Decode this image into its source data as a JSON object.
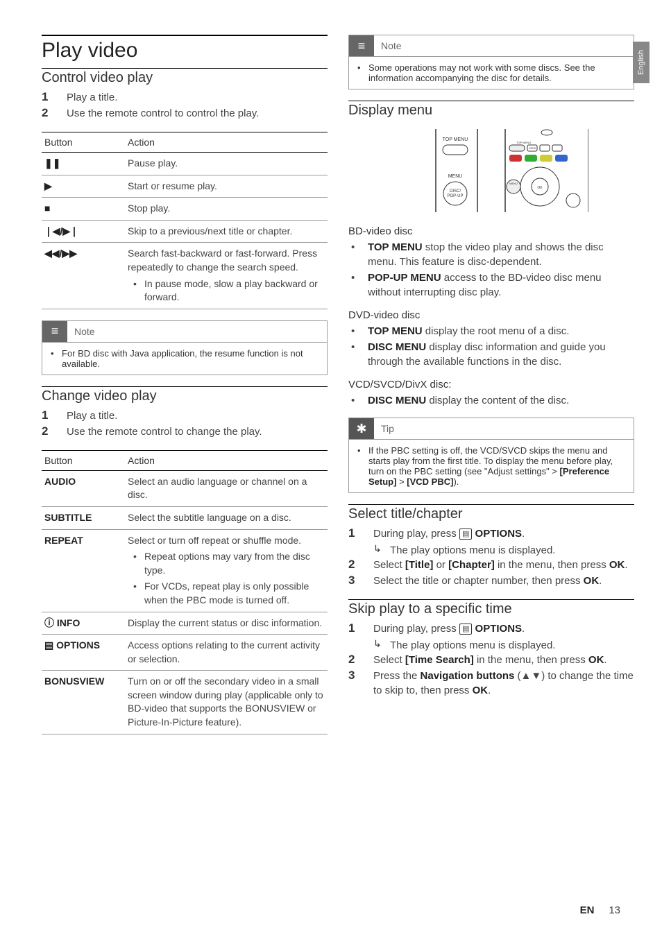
{
  "page": {
    "lang_tab": "English",
    "footer_lang": "EN",
    "footer_page": "13"
  },
  "left": {
    "h1": "Play video",
    "section1": {
      "heading": "Control video play",
      "steps": [
        "Play a title.",
        "Use the remote control to control the play."
      ],
      "table": {
        "headers": [
          "Button",
          "Action"
        ],
        "rows": [
          {
            "btn": "❚❚",
            "action": "Pause play."
          },
          {
            "btn": "▶",
            "action": "Start or resume play."
          },
          {
            "btn": "■",
            "action": "Stop play."
          },
          {
            "btn": "❘◀/▶❘",
            "action": "Skip to a previous/next title or chapter."
          },
          {
            "btn": "◀◀/▶▶",
            "action": "Search fast-backward or fast-forward. Press repeatedly to change the search speed.",
            "sub": "In pause mode, slow a play backward or forward."
          }
        ]
      },
      "note": {
        "title": "Note",
        "text": "For BD disc with Java application, the resume function is not available."
      }
    },
    "section2": {
      "heading": "Change video play",
      "steps": [
        "Play a title.",
        "Use the remote control to change the play."
      ],
      "table": {
        "headers": [
          "Button",
          "Action"
        ],
        "rows": [
          {
            "btn": "AUDIO",
            "action": "Select an audio language or channel on a disc."
          },
          {
            "btn": "SUBTITLE",
            "action": "Select the subtitle language on a disc."
          },
          {
            "btn": "REPEAT",
            "action": "Select or turn off repeat or shuffle mode.",
            "subs": [
              "Repeat options may vary from the disc type.",
              "For VCDs, repeat play is only possible when the PBC mode is turned off."
            ]
          },
          {
            "btn": "ⓘ INFO",
            "action": "Display the current status or disc information."
          },
          {
            "btn": "▤ OPTIONS",
            "action": "Access options relating to the current activity or selection."
          },
          {
            "btn": "BONUSVIEW",
            "action": "Turn on or off the secondary video in a small screen window during play (applicable only to BD-video that supports the BONUSVIEW or Picture-In-Picture feature)."
          }
        ]
      }
    }
  },
  "right": {
    "note1": {
      "title": "Note",
      "text": "Some operations may not work with some discs. See the information accompanying the disc for details."
    },
    "section1": {
      "heading": "Display menu",
      "diagram_labels": {
        "top_menu": "TOP MENU",
        "menu": "MENU",
        "disc_popup": "DISC/\nPOP-UP"
      },
      "bd": {
        "title": "BD-video disc",
        "items": [
          {
            "lead": "TOP MENU",
            "text": " stop the video play and shows the disc menu. This feature is disc-dependent."
          },
          {
            "lead": "POP-UP MENU",
            "text": " access to the BD-video disc menu without interrupting disc play."
          }
        ]
      },
      "dvd": {
        "title": "DVD-video disc",
        "items": [
          {
            "lead": "TOP MENU",
            "text": " display the root menu of a disc."
          },
          {
            "lead": "DISC MENU",
            "text": " display disc information and guide you through the available functions in the disc."
          }
        ]
      },
      "vcd": {
        "title": "VCD/SVCD/DivX disc:",
        "items": [
          {
            "lead": "DISC MENU",
            "text": " display the content of the disc."
          }
        ]
      },
      "tip": {
        "title": "Tip",
        "text_parts": {
          "p1": "If the PBC setting is off, the VCD/SVCD skips the menu and starts play from the first title. To display the menu before play, turn on the PBC setting (see \"Adjust settings\" > ",
          "b1": "[Preference Setup]",
          "p2": " > ",
          "b2": "[VCD PBC]",
          "p3": ")."
        }
      }
    },
    "section2": {
      "heading": "Select title/chapter",
      "steps": [
        {
          "main_parts": {
            "p1": "During play, press ",
            "icon": "▤",
            "b1": " OPTIONS",
            "p2": "."
          },
          "sub": "The play options menu is displayed."
        },
        {
          "main_parts": {
            "p1": "Select ",
            "b1": "[Title]",
            "p2": " or ",
            "b2": "[Chapter]",
            "p3": " in the menu, then press ",
            "b3": "OK",
            "p4": "."
          }
        },
        {
          "main_parts": {
            "p1": "Select the title or chapter number, then press ",
            "b1": "OK",
            "p2": "."
          }
        }
      ]
    },
    "section3": {
      "heading": "Skip play to a specific time",
      "steps": [
        {
          "main_parts": {
            "p1": "During play, press ",
            "icon": "▤",
            "b1": " OPTIONS",
            "p2": "."
          },
          "sub": "The play options menu is displayed."
        },
        {
          "main_parts": {
            "p1": "Select ",
            "b1": "[Time Search]",
            "p2": " in the menu, then press ",
            "b2": "OK",
            "p3": "."
          }
        },
        {
          "main_parts": {
            "p1": "Press the ",
            "b1": "Navigation buttons",
            "p2": " (▲▼) to change the time to skip to, then press ",
            "b2": "OK",
            "p3": "."
          }
        }
      ]
    }
  }
}
